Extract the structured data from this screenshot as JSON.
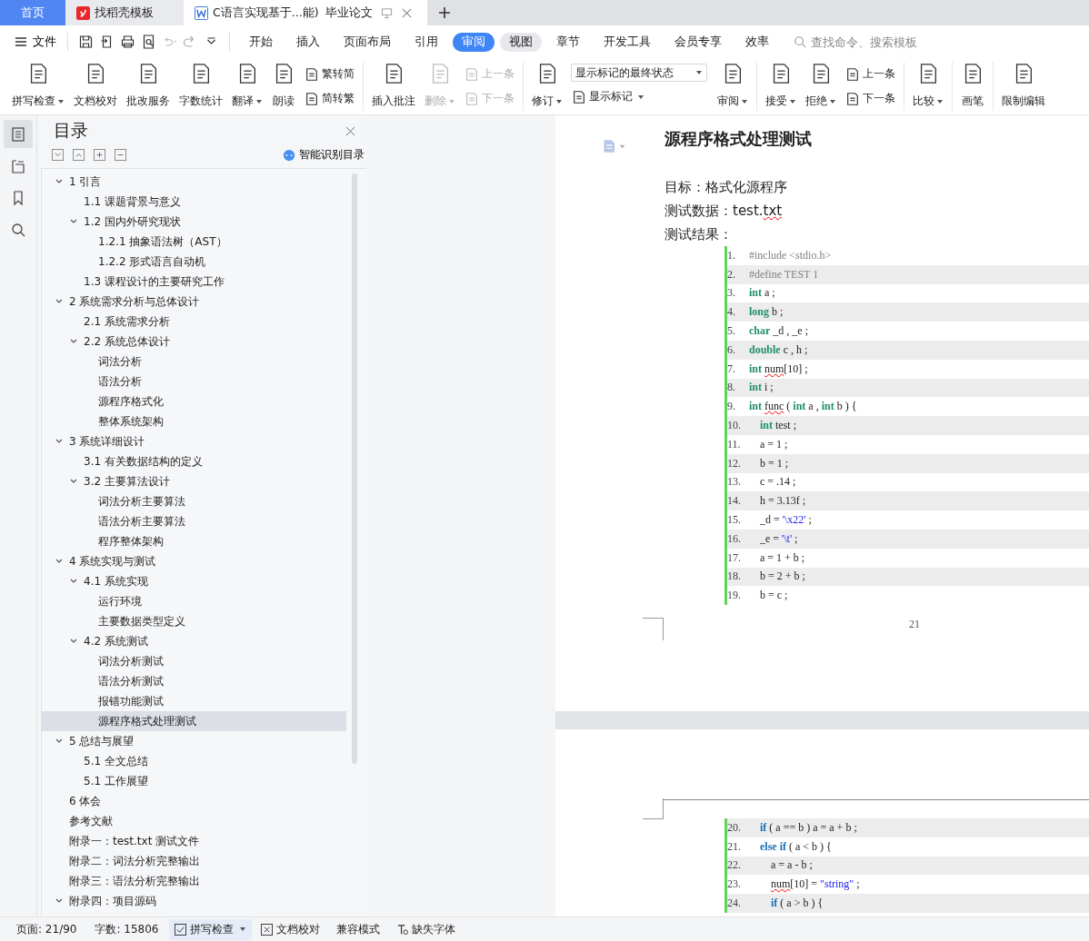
{
  "tabs": [
    {
      "label": "首页",
      "kind": "home",
      "selected": false
    },
    {
      "label": "找稻壳模板",
      "kind": "template",
      "selected": false
    },
    {
      "label": "C语言实现基于...能)  毕业论文",
      "kind": "document",
      "selected": true
    }
  ],
  "menu": {
    "file": "文件",
    "tabs": [
      {
        "label": "开始",
        "selected": false,
        "hovered": false
      },
      {
        "label": "插入",
        "selected": false,
        "hovered": false
      },
      {
        "label": "页面布局",
        "selected": false,
        "hovered": false
      },
      {
        "label": "引用",
        "selected": false,
        "hovered": false
      },
      {
        "label": "审阅",
        "selected": true,
        "hovered": false
      },
      {
        "label": "视图",
        "selected": false,
        "hovered": true
      },
      {
        "label": "章节",
        "selected": false,
        "hovered": false
      },
      {
        "label": "开发工具",
        "selected": false,
        "hovered": false
      },
      {
        "label": "会员专享",
        "selected": false,
        "hovered": false
      },
      {
        "label": "效率",
        "selected": false,
        "hovered": false
      }
    ],
    "search": {
      "placeholder": "查找命令、搜索模板"
    }
  },
  "ribbon": [
    {
      "items": [
        {
          "label": "拼写检查",
          "kind": "large",
          "dropdown": true,
          "disabled": false
        },
        {
          "label": "文档校对",
          "kind": "large",
          "dropdown": false,
          "disabled": false
        },
        {
          "label": "批改服务",
          "kind": "large",
          "dropdown": false,
          "disabled": false
        },
        {
          "label": "字数统计",
          "kind": "large",
          "dropdown": false,
          "disabled": false
        },
        {
          "label": "翻译",
          "kind": "large",
          "dropdown": true,
          "disabled": false
        },
        {
          "label": "朗读",
          "kind": "large",
          "dropdown": false,
          "disabled": false
        },
        {
          "label": "繁转简",
          "kind": "small",
          "dropdown": false,
          "disabled": false
        },
        {
          "label": "简转繁",
          "kind": "small",
          "dropdown": false,
          "disabled": false
        }
      ]
    },
    {
      "items": [
        {
          "label": "插入批注",
          "kind": "large",
          "dropdown": false,
          "disabled": false
        },
        {
          "label": "删除",
          "kind": "large",
          "dropdown": true,
          "disabled": true
        },
        {
          "label": "上一条",
          "kind": "small",
          "dropdown": false,
          "disabled": true
        },
        {
          "label": "下一条",
          "kind": "small",
          "dropdown": false,
          "disabled": true
        }
      ]
    },
    {
      "items": [
        {
          "label": "修订",
          "kind": "large",
          "dropdown": true,
          "disabled": false
        },
        {
          "label": "显示标记的最终状态",
          "kind": "select",
          "dropdown": true,
          "disabled": false
        },
        {
          "label": "显示标记",
          "kind": "small",
          "dropdown": true,
          "disabled": false
        },
        {
          "label": "审阅",
          "kind": "large",
          "dropdown": true,
          "disabled": false
        }
      ]
    },
    {
      "items": [
        {
          "label": "接受",
          "kind": "large",
          "dropdown": true,
          "disabled": false
        },
        {
          "label": "拒绝",
          "kind": "large",
          "dropdown": true,
          "disabled": false
        },
        {
          "label": "上一条",
          "kind": "small",
          "dropdown": false,
          "disabled": false
        },
        {
          "label": "下一条",
          "kind": "small",
          "dropdown": false,
          "disabled": false
        }
      ]
    },
    {
      "items": [
        {
          "label": "比较",
          "kind": "large",
          "dropdown": true,
          "disabled": false
        }
      ]
    },
    {
      "items": [
        {
          "label": "画笔",
          "kind": "large",
          "dropdown": false,
          "disabled": false
        }
      ]
    },
    {
      "items": [
        {
          "label": "限制编辑",
          "kind": "large",
          "dropdown": false,
          "disabled": false
        }
      ]
    }
  ],
  "side_strip": [
    {
      "selected": true
    },
    {
      "selected": false
    },
    {
      "selected": false
    },
    {
      "selected": false
    }
  ],
  "toc": {
    "title": "目录",
    "smart_button": "智能识别目录",
    "items": [
      {
        "label": "1 引言",
        "expanded": true,
        "selected": false,
        "children": [
          {
            "label": "1.1 课题背景与意义",
            "selected": false
          },
          {
            "label": "1.2 国内外研究现状",
            "expanded": true,
            "selected": false,
            "children": [
              {
                "label": "1.2.1  抽象语法树（AST）",
                "selected": false
              },
              {
                "label": "1.2.2  形式语言自动机",
                "selected": false
              }
            ]
          },
          {
            "label": "1.3 课程设计的主要研究工作",
            "selected": false
          }
        ]
      },
      {
        "label": "2 系统需求分析与总体设计",
        "expanded": true,
        "selected": false,
        "children": [
          {
            "label": "2.1 系统需求分析",
            "selected": false
          },
          {
            "label": "2.2 系统总体设计",
            "expanded": true,
            "selected": false,
            "children": [
              {
                "label": "词法分析",
                "selected": false
              },
              {
                "label": "语法分析",
                "selected": false
              },
              {
                "label": "源程序格式化",
                "selected": false
              },
              {
                "label": "整体系统架构",
                "selected": false
              }
            ]
          }
        ]
      },
      {
        "label": "3 系统详细设计",
        "expanded": true,
        "selected": false,
        "children": [
          {
            "label": "3.1 有关数据结构的定义",
            "selected": false
          },
          {
            "label": "3.2  主要算法设计",
            "expanded": true,
            "selected": false,
            "children": [
              {
                "label": "词法分析主要算法",
                "selected": false
              },
              {
                "label": "语法分析主要算法",
                "selected": false
              },
              {
                "label": "程序整体架构",
                "selected": false
              }
            ]
          }
        ]
      },
      {
        "label": "4 系统实现与测试",
        "expanded": true,
        "selected": false,
        "children": [
          {
            "label": "4.1 系统实现",
            "expanded": true,
            "selected": false,
            "children": [
              {
                "label": "运行环境",
                "selected": false
              },
              {
                "label": "主要数据类型定义",
                "selected": false
              }
            ]
          },
          {
            "label": "4.2 系统测试",
            "expanded": true,
            "selected": false,
            "children": [
              {
                "label": "词法分析测试",
                "selected": false
              },
              {
                "label": "语法分析测试",
                "selected": false
              },
              {
                "label": "报错功能测试",
                "selected": false
              },
              {
                "label": "源程序格式处理测试",
                "selected": true
              }
            ]
          }
        ]
      },
      {
        "label": "5 总结与展望",
        "expanded": true,
        "selected": false,
        "children": [
          {
            "label": "5.1 全文总结",
            "selected": false
          },
          {
            "label": "5.1 工作展望",
            "selected": false
          }
        ]
      },
      {
        "label": "6    体会",
        "selected": false
      },
      {
        "label": "参考文献",
        "selected": false
      },
      {
        "label": "附录一：test.txt 测试文件",
        "selected": false
      },
      {
        "label": "附录二：词法分析完整输出",
        "selected": false
      },
      {
        "label": "附录三：语法分析完整输出",
        "selected": false
      },
      {
        "label": "附录四：项目源码",
        "expanded": true,
        "selected": false
      }
    ]
  },
  "document": {
    "heading": "源程序格式处理测试",
    "paragraphs": [
      [
        {
          "t": "目标：格式化源程序",
          "kind": "plain"
        }
      ],
      [
        {
          "t": "测试数据：test.",
          "kind": "plain"
        },
        {
          "t": "txt",
          "kind": "misspelled"
        }
      ],
      [
        {
          "t": "测试结果：",
          "kind": "plain"
        }
      ]
    ],
    "page_number": "21",
    "pages": [
      {
        "code": [
          {
            "num": "1.",
            "kind": "top",
            "shaded": false,
            "tokens": [
              {
                "t": "#include <stdio.h>",
                "kind": "preprocessor"
              }
            ]
          },
          {
            "num": "2.",
            "kind": "top",
            "shaded": true,
            "tokens": [
              {
                "t": "#define TEST 1",
                "kind": "preprocessor"
              }
            ]
          },
          {
            "num": "3.",
            "kind": "top",
            "shaded": false,
            "tokens": [
              {
                "t": "int",
                "kind": "type"
              },
              {
                "t": " a ;",
                "kind": "plain"
              }
            ]
          },
          {
            "num": "4.",
            "kind": "top",
            "shaded": true,
            "tokens": [
              {
                "t": "long",
                "kind": "type"
              },
              {
                "t": " b ;",
                "kind": "plain"
              }
            ]
          },
          {
            "num": "5.",
            "kind": "top",
            "shaded": false,
            "tokens": [
              {
                "t": "char",
                "kind": "type"
              },
              {
                "t": " _d , _e ;",
                "kind": "plain"
              }
            ]
          },
          {
            "num": "6.",
            "kind": "top",
            "shaded": true,
            "tokens": [
              {
                "t": "double",
                "kind": "type"
              },
              {
                "t": " c , h ;",
                "kind": "plain"
              }
            ]
          },
          {
            "num": "7.",
            "kind": "top",
            "shaded": false,
            "tokens": [
              {
                "t": "int ",
                "kind": "type"
              },
              {
                "t": "num",
                "kind": "misspelled"
              },
              {
                "t": "[10] ;",
                "kind": "plain"
              }
            ]
          },
          {
            "num": "8.",
            "kind": "top",
            "shaded": true,
            "tokens": [
              {
                "t": "int",
                "kind": "type"
              },
              {
                "t": " i ;",
                "kind": "plain"
              }
            ]
          },
          {
            "num": "9.",
            "kind": "top",
            "shaded": false,
            "tokens": [
              {
                "t": "int ",
                "kind": "type"
              },
              {
                "t": "func",
                "kind": "misspelled"
              },
              {
                "t": " ( ",
                "kind": "plain"
              },
              {
                "t": "int",
                "kind": "type"
              },
              {
                "t": " a , ",
                "kind": "plain"
              },
              {
                "t": "int",
                "kind": "type"
              },
              {
                "t": " b ) {",
                "kind": "plain"
              }
            ]
          },
          {
            "num": "10.",
            "kind": "inner",
            "shaded": true,
            "tokens": [
              {
                "t": "int",
                "kind": "type"
              },
              {
                "t": " test ;",
                "kind": "plain"
              }
            ]
          },
          {
            "num": "11.",
            "kind": "inner",
            "shaded": false,
            "tokens": [
              {
                "t": "a = 1 ;",
                "kind": "plain"
              }
            ]
          },
          {
            "num": "12.",
            "kind": "inner",
            "shaded": true,
            "tokens": [
              {
                "t": "b = 1 ;",
                "kind": "plain"
              }
            ]
          },
          {
            "num": "13.",
            "kind": "inner",
            "shaded": false,
            "tokens": [
              {
                "t": "c = .14 ;",
                "kind": "plain"
              }
            ]
          },
          {
            "num": "14.",
            "kind": "inner",
            "shaded": true,
            "tokens": [
              {
                "t": "h = 3.13f ;",
                "kind": "plain"
              }
            ]
          },
          {
            "num": "15.",
            "kind": "inner",
            "shaded": false,
            "tokens": [
              {
                "t": "_d = ",
                "kind": "plain"
              },
              {
                "t": "'\\x22'",
                "kind": "string"
              },
              {
                "t": " ;",
                "kind": "plain"
              }
            ]
          },
          {
            "num": "16.",
            "kind": "inner",
            "shaded": true,
            "tokens": [
              {
                "t": "_e = ",
                "kind": "plain"
              },
              {
                "t": "'\\t'",
                "kind": "string"
              },
              {
                "t": " ;",
                "kind": "plain"
              }
            ]
          },
          {
            "num": "17.",
            "kind": "inner",
            "shaded": false,
            "tokens": [
              {
                "t": "a = 1 + b ;",
                "kind": "plain"
              }
            ]
          },
          {
            "num": "18.",
            "kind": "inner",
            "shaded": true,
            "tokens": [
              {
                "t": "b = 2 + b ;",
                "kind": "plain"
              }
            ]
          },
          {
            "num": "19.",
            "kind": "inner",
            "shaded": false,
            "tokens": [
              {
                "t": "b = c ;",
                "kind": "plain"
              }
            ]
          }
        ]
      },
      {
        "code": [
          {
            "num": "20.",
            "kind": "inner",
            "shaded": true,
            "tokens": [
              {
                "t": "if",
                "kind": "keyword"
              },
              {
                "t": " ( a == b ) a = a + b ;",
                "kind": "plain"
              }
            ]
          },
          {
            "num": "21.",
            "kind": "inner",
            "shaded": false,
            "tokens": [
              {
                "t": "else if",
                "kind": "keyword"
              },
              {
                "t": " ( a < b ) {",
                "kind": "plain"
              }
            ]
          },
          {
            "num": "22.",
            "kind": "inner2",
            "shaded": true,
            "tokens": [
              {
                "t": "a = a - b ;",
                "kind": "plain"
              }
            ]
          },
          {
            "num": "23.",
            "kind": "inner2",
            "shaded": false,
            "tokens": [
              {
                "t": "num",
                "kind": "misspelled"
              },
              {
                "t": "[10] = ",
                "kind": "plain"
              },
              {
                "t": "\"string\"",
                "kind": "string"
              },
              {
                "t": " ;",
                "kind": "plain"
              }
            ]
          },
          {
            "num": "24.",
            "kind": "inner2",
            "shaded": true,
            "tokens": [
              {
                "t": "if",
                "kind": "keyword"
              },
              {
                "t": " ( a > b ) {",
                "kind": "plain"
              }
            ]
          }
        ]
      }
    ]
  },
  "status_bar": {
    "page": "页面: 21/90",
    "words": "字数: 15806",
    "spell_check": "拼写检查",
    "proofread": "文档校对",
    "mode": "兼容模式",
    "missing_fonts": "缺失字体"
  }
}
